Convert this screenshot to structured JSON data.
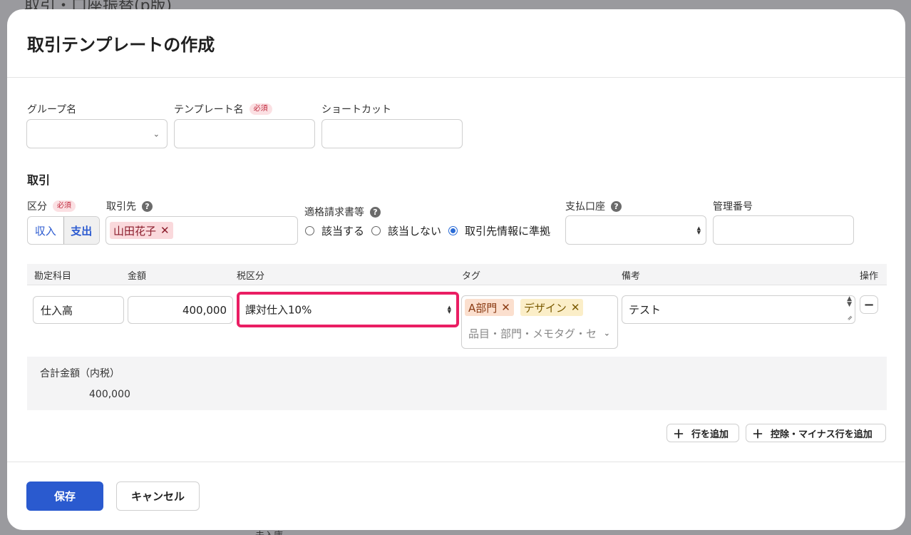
{
  "background": {
    "title": "取引・口座振替(p版)",
    "text": "未入庫"
  },
  "modal": {
    "title": "取引テンプレートの作成",
    "required_badge": "必須",
    "top_fields": {
      "group_label": "グループ名",
      "template_label": "テンプレート名",
      "shortcut_label": "ショートカット"
    },
    "section_title": "取引",
    "transaction": {
      "kubun_label": "区分",
      "kubun_options": [
        "収入",
        "支出"
      ],
      "kubun_selected": "支出",
      "partner_label": "取引先",
      "partner_chip": "山田花子",
      "invoice_label": "適格請求書等",
      "invoice_options": [
        "該当する",
        "該当しない",
        "取引先情報に準拠"
      ],
      "invoice_selected": "取引先情報に準拠",
      "account_label": "支払口座",
      "mgmt_label": "管理番号"
    },
    "table": {
      "headers": [
        "勘定科目",
        "金額",
        "税区分",
        "タグ",
        "備考",
        "操作"
      ],
      "row": {
        "account": "仕入高",
        "amount": "400,000",
        "tax": "課対仕入10%",
        "tags": [
          "A部門",
          "デザイン"
        ],
        "tag_placeholder": "品目・部門・メモタグ・セ",
        "memo": "テスト"
      }
    },
    "total": {
      "label": "合計金額（内税）",
      "value": "400,000"
    },
    "add_row": "行を追加",
    "add_minus_row": "控除・マイナス行を追加",
    "save": "保存",
    "cancel": "キャンセル"
  },
  "colors": {
    "primary": "#2a5acf",
    "highlight": "#ea1e63",
    "required": "#c0283c"
  },
  "icons": [
    "chevron-down-icon",
    "help-icon",
    "close-icon",
    "plus-icon",
    "minus-icon",
    "updown-icon",
    "resize-icon"
  ]
}
